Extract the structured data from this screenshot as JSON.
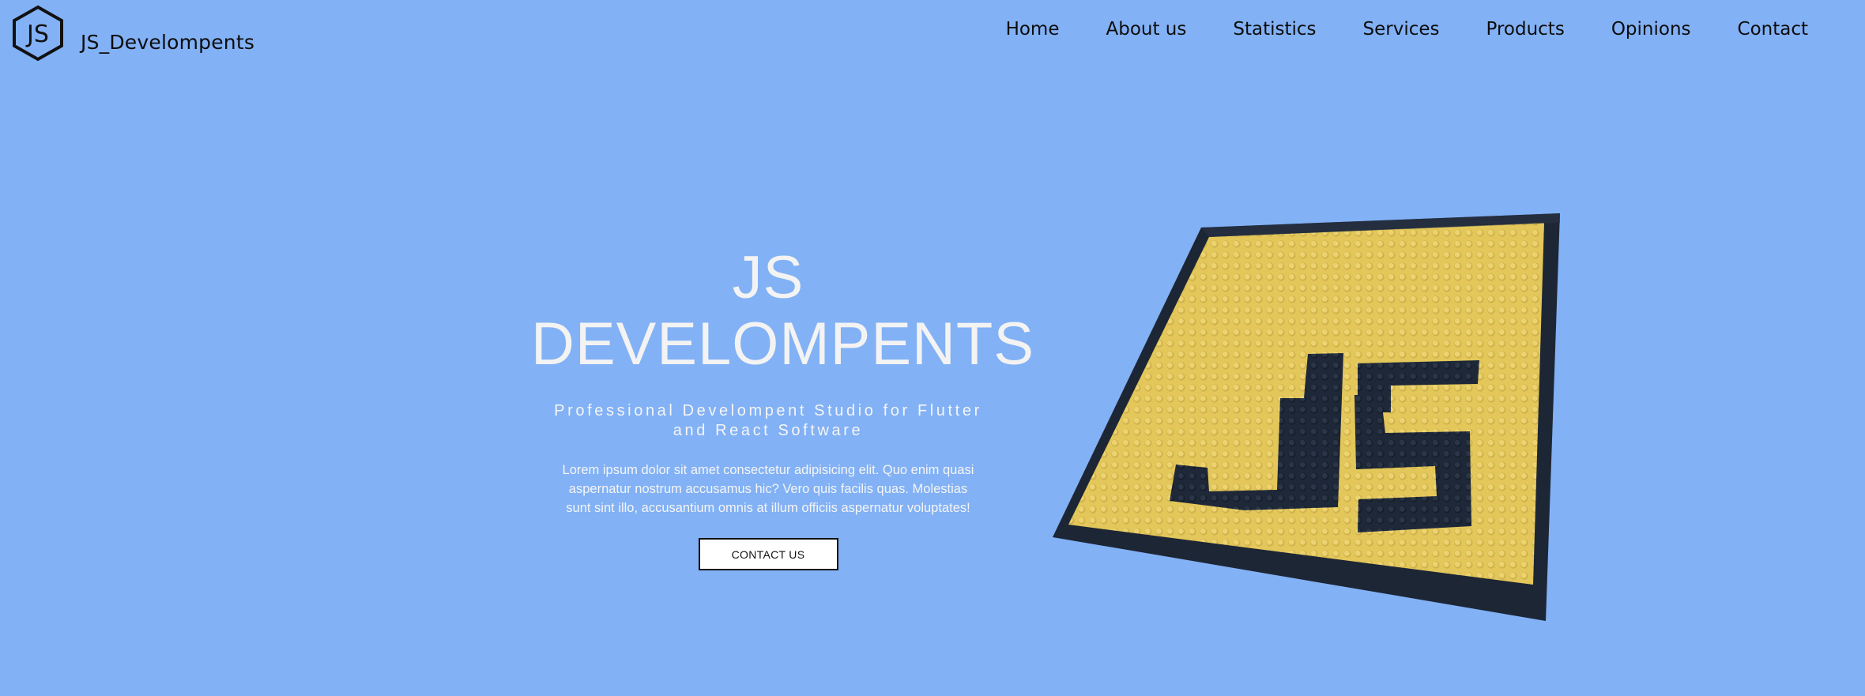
{
  "header": {
    "logo_text": "JS",
    "brand": "JS_Develompents",
    "nav": [
      "Home",
      "About us",
      "Statistics",
      "Services",
      "Products",
      "Opinions",
      "Contact"
    ]
  },
  "hero": {
    "title_line1": "JS",
    "title_line2": "DEVELOMPENTS",
    "subtitle": "Professional Develompent Studio for Flutter and React Software",
    "body": "Lorem ipsum dolor sit amet consectetur adipisicing elit. Quo enim quasi aspernatur nostrum accusamus hic? Vero quis facilis quas. Molestias sunt sint illo, accusantium omnis at illum officiis aspernatur voluptates!",
    "cta": "CONTACT US"
  },
  "art": {
    "icon": "js-lego-image",
    "letters": "JS"
  },
  "colors": {
    "background": "#82b1f5",
    "lego_yellow": "#e5c95a",
    "lego_dark": "#1f2a3a"
  }
}
